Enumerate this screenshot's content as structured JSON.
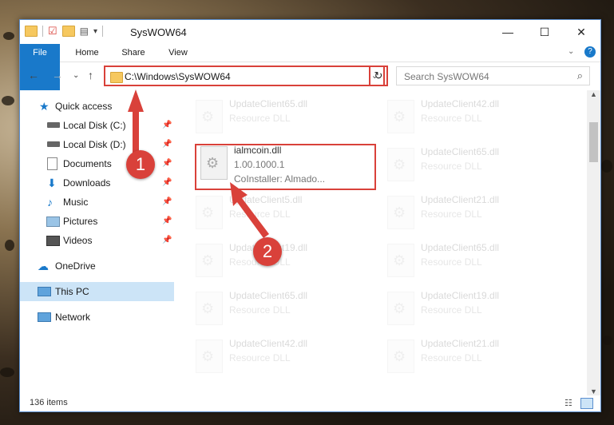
{
  "window": {
    "title": "SysWOW64",
    "minimize": "—",
    "maximize": "☐",
    "close": "✕"
  },
  "ribbon": {
    "tabs": [
      "File",
      "Home",
      "Share",
      "View"
    ]
  },
  "address": {
    "path": "C:\\Windows\\SysWOW64",
    "search_placeholder": "Search SysWOW64"
  },
  "sidebar": {
    "items": [
      {
        "label": "Quick access"
      },
      {
        "label": "Local Disk (C:)"
      },
      {
        "label": "Local Disk (D:)"
      },
      {
        "label": "Documents"
      },
      {
        "label": "Downloads"
      },
      {
        "label": "Music"
      },
      {
        "label": "Pictures"
      },
      {
        "label": "Videos"
      },
      {
        "label": "OneDrive"
      },
      {
        "label": "This PC"
      },
      {
        "label": "Network"
      }
    ]
  },
  "files": {
    "col1": [
      {
        "name": "UpdateClient65.dll",
        "desc": "Resource DLL"
      },
      {
        "name": "ialmcoin.dll",
        "desc": "1.00.1000.1",
        "desc2": "CoInstaller: Almado..."
      },
      {
        "name": "UpdateClient5.dll",
        "desc": "Resource DLL"
      },
      {
        "name": "UpdateClient19.dll",
        "desc": "Resource DLL"
      },
      {
        "name": "UpdateClient65.dll",
        "desc": "Resource DLL"
      },
      {
        "name": "UpdateClient42.dll",
        "desc": "Resource DLL"
      }
    ],
    "col2": [
      {
        "name": "UpdateClient42.dll",
        "desc": "Resource DLL"
      },
      {
        "name": "UpdateClient65.dll",
        "desc": "Resource DLL"
      },
      {
        "name": "UpdateClient21.dll",
        "desc": "Resource DLL"
      },
      {
        "name": "UpdateClient65.dll",
        "desc": "Resource DLL"
      },
      {
        "name": "UpdateClient19.dll",
        "desc": "Resource DLL"
      },
      {
        "name": "UpdateClient21.dll",
        "desc": "Resource DLL"
      }
    ]
  },
  "status": {
    "count": "136 items"
  },
  "annotations": [
    "1",
    "2"
  ],
  "colors": {
    "accent": "#1979ca",
    "highlight": "#d9413a"
  }
}
